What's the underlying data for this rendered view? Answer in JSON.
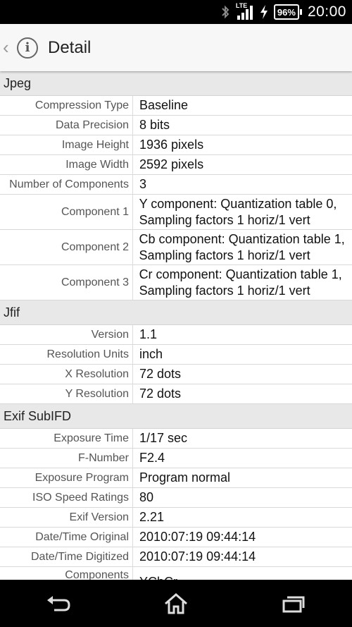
{
  "status_bar": {
    "network": "LTE",
    "battery": "96%",
    "time": "20:00"
  },
  "action_bar": {
    "title": "Detail"
  },
  "sections": [
    {
      "title": "Jpeg",
      "rows": [
        {
          "label": "Compression Type",
          "value": "Baseline"
        },
        {
          "label": "Data Precision",
          "value": "8 bits"
        },
        {
          "label": "Image Height",
          "value": "1936 pixels"
        },
        {
          "label": "Image Width",
          "value": "2592 pixels"
        },
        {
          "label": "Number of Components",
          "value": "3"
        },
        {
          "label": "Component 1",
          "value": "Y component: Quantization table 0, Sampling factors 1 horiz/1 vert"
        },
        {
          "label": "Component 2",
          "value": "Cb component: Quantization table 1, Sampling factors 1 horiz/1 vert"
        },
        {
          "label": "Component 3",
          "value": "Cr component: Quantization table 1, Sampling factors 1 horiz/1 vert"
        }
      ]
    },
    {
      "title": "Jfif",
      "rows": [
        {
          "label": "Version",
          "value": "1.1"
        },
        {
          "label": "Resolution Units",
          "value": "inch"
        },
        {
          "label": "X Resolution",
          "value": "72 dots"
        },
        {
          "label": "Y Resolution",
          "value": "72 dots"
        }
      ]
    },
    {
      "title": "Exif SubIFD",
      "rows": [
        {
          "label": "Exposure Time",
          "value": "1/17 sec"
        },
        {
          "label": "F-Number",
          "value": "F2.4"
        },
        {
          "label": "Exposure Program",
          "value": "Program normal"
        },
        {
          "label": "ISO Speed Ratings",
          "value": "80"
        },
        {
          "label": "Exif Version",
          "value": "2.21"
        },
        {
          "label": "Date/Time Original",
          "value": "2010:07:19 09:44:14"
        },
        {
          "label": "Date/Time Digitized",
          "value": "2010:07:19 09:44:14"
        },
        {
          "label": "Components",
          "value": "YCbCr"
        }
      ]
    }
  ],
  "nav_bar": {
    "icons": [
      "back-icon",
      "home-icon",
      "recent-apps-icon"
    ]
  }
}
